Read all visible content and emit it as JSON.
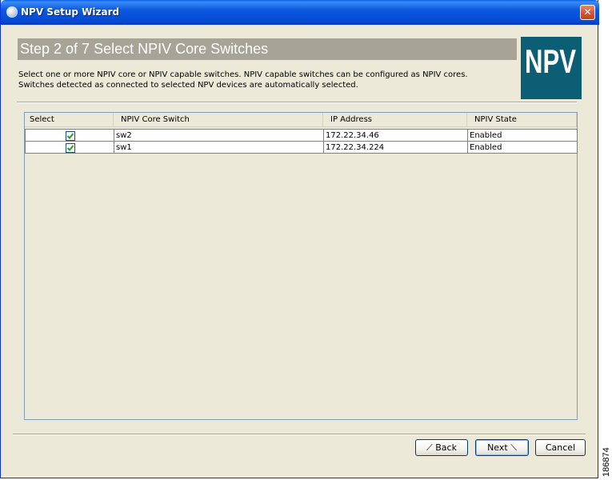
{
  "window": {
    "title": "NPV Setup Wizard"
  },
  "header": {
    "step_title": "Step 2 of 7 Select NPIV Core Switches",
    "logo_text": "NPV"
  },
  "description": {
    "line1": "Select one or more NPIV core or NPIV capable switches.  NPIV capable switches can be configured as NPIV cores.",
    "line2": "Switches detected as connected to selected NPV devices are automatically selected."
  },
  "table": {
    "columns": [
      "Select",
      "NPIV Core Switch",
      "IP Address",
      "NPIV State"
    ],
    "rows": [
      {
        "selected": true,
        "switch": "sw2",
        "ip": "172.22.34.46",
        "state": "Enabled"
      },
      {
        "selected": true,
        "switch": "sw1",
        "ip": "172.22.34.224",
        "state": "Enabled"
      }
    ]
  },
  "buttons": {
    "back": "Back",
    "next": "Next",
    "cancel": "Cancel"
  },
  "side_label": "186874",
  "colors": {
    "titlebar": "#0548d4",
    "step_header_bg": "#a7a497",
    "logo_bg": "#0c5e74",
    "checkmark": "#21a121"
  }
}
